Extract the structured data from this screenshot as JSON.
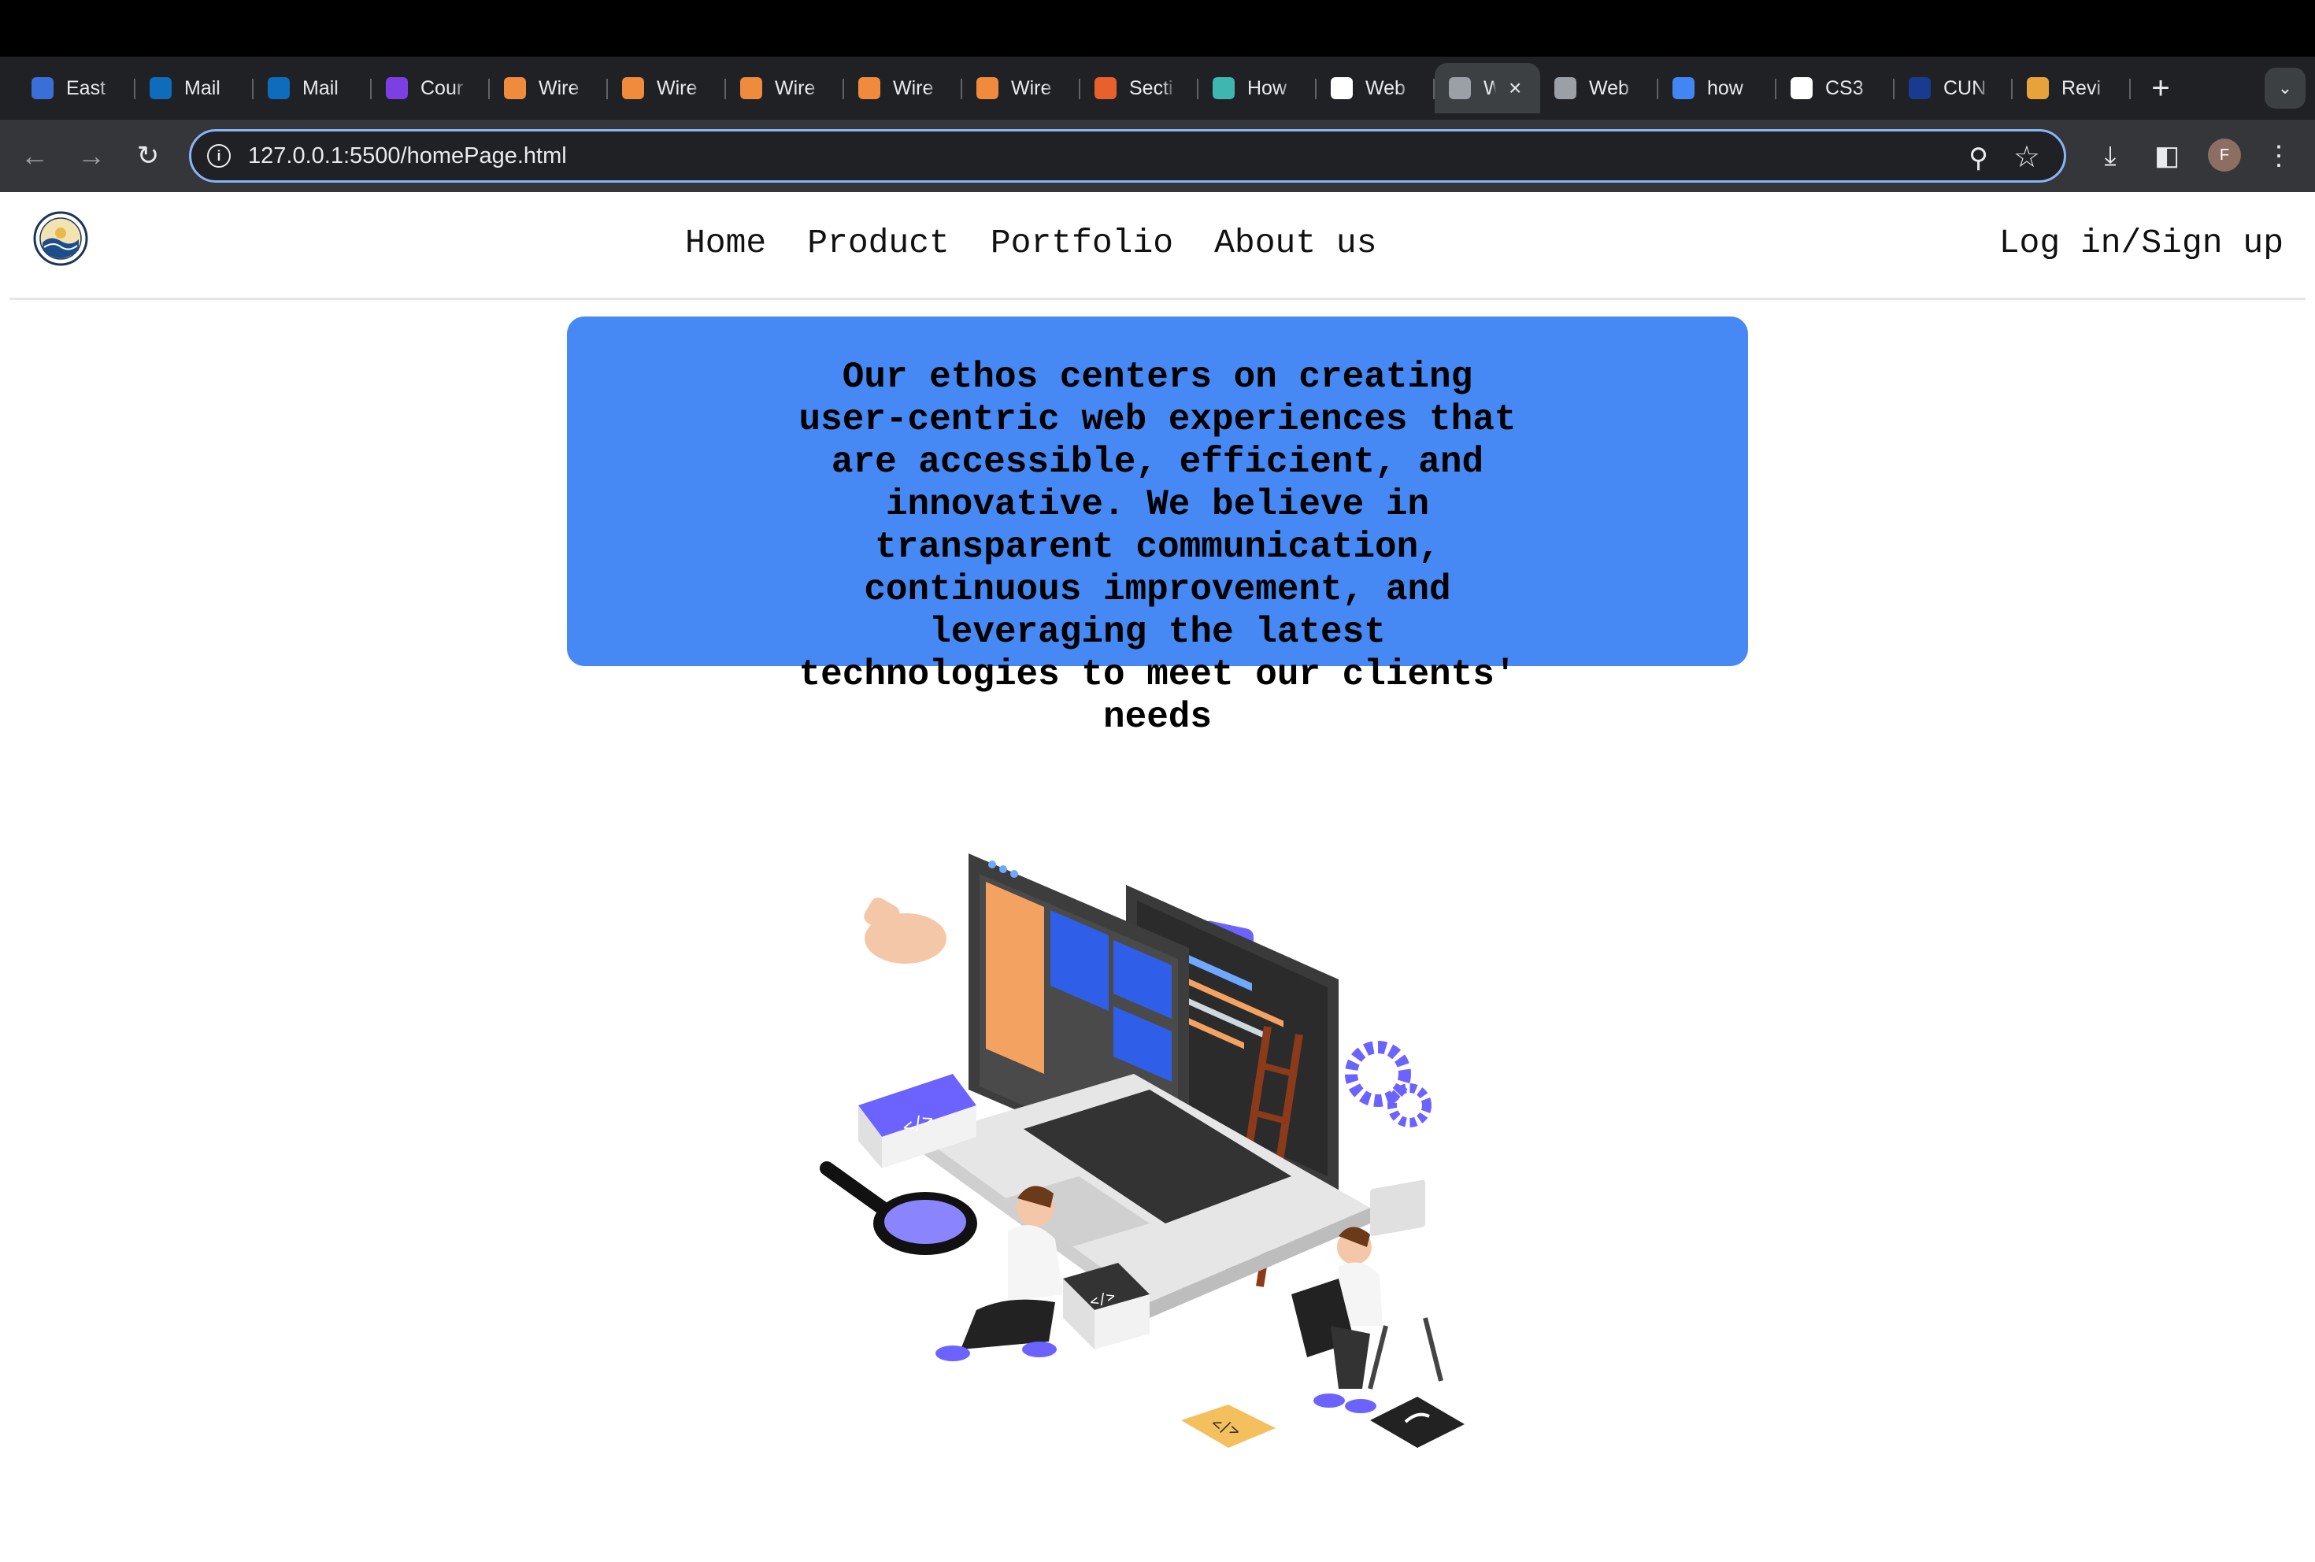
{
  "browser": {
    "tabs": [
      {
        "label": "East",
        "icon": "lock-icon",
        "color": "#3b6fd8"
      },
      {
        "label": "Mail",
        "icon": "outlook-icon",
        "color": "#0f6cbd"
      },
      {
        "label": "Mail",
        "icon": "outlook-icon",
        "color": "#0f6cbd"
      },
      {
        "label": "Cour",
        "icon": "course-icon",
        "color": "#7b3fe4"
      },
      {
        "label": "Wire",
        "icon": "wireframe-icon",
        "color": "#f08a3c"
      },
      {
        "label": "Wire",
        "icon": "wireframe-icon",
        "color": "#f08a3c"
      },
      {
        "label": "Wire",
        "icon": "wireframe-icon",
        "color": "#f08a3c"
      },
      {
        "label": "Wire",
        "icon": "wireframe-icon",
        "color": "#f08a3c"
      },
      {
        "label": "Wire",
        "icon": "wireframe-icon",
        "color": "#f08a3c"
      },
      {
        "label": "Secti",
        "icon": "zybooks-icon",
        "color": "#e8602c"
      },
      {
        "label": "How",
        "icon": "s-icon",
        "color": "#3fb6b0"
      },
      {
        "label": "Web",
        "icon": "squarespace-icon",
        "color": "#ffffff"
      },
      {
        "label": "W",
        "icon": "globe-icon",
        "color": "#9aa0a6",
        "active": true
      },
      {
        "label": "Web",
        "icon": "globe-icon",
        "color": "#9aa0a6"
      },
      {
        "label": "how",
        "icon": "google-icon",
        "color": "#4285f4"
      },
      {
        "label": "CS3",
        "icon": "github-icon",
        "color": "#ffffff"
      },
      {
        "label": "CUN",
        "icon": "cuny-icon",
        "color": "#1a3a8f"
      },
      {
        "label": "Revi",
        "icon": "chart-icon",
        "color": "#e8a23c"
      }
    ],
    "url": "127.0.0.1:5500/homePage.html",
    "profile_initial": "F"
  },
  "site": {
    "nav": {
      "items": [
        "Home",
        "Product",
        "Portfolio",
        "About us"
      ],
      "login": "Log in/Sign up"
    },
    "ethos_text": "Our ethos centers on creating user-centric web experiences that are accessible, efficient, and innovative. We believe in transparent communication, continuous improvement, and leveraging the latest technologies to meet our clients' needs",
    "colors": {
      "ethos_bg": "#4689f4",
      "accent_purple": "#6c63ff",
      "accent_orange": "#f4a261"
    }
  }
}
